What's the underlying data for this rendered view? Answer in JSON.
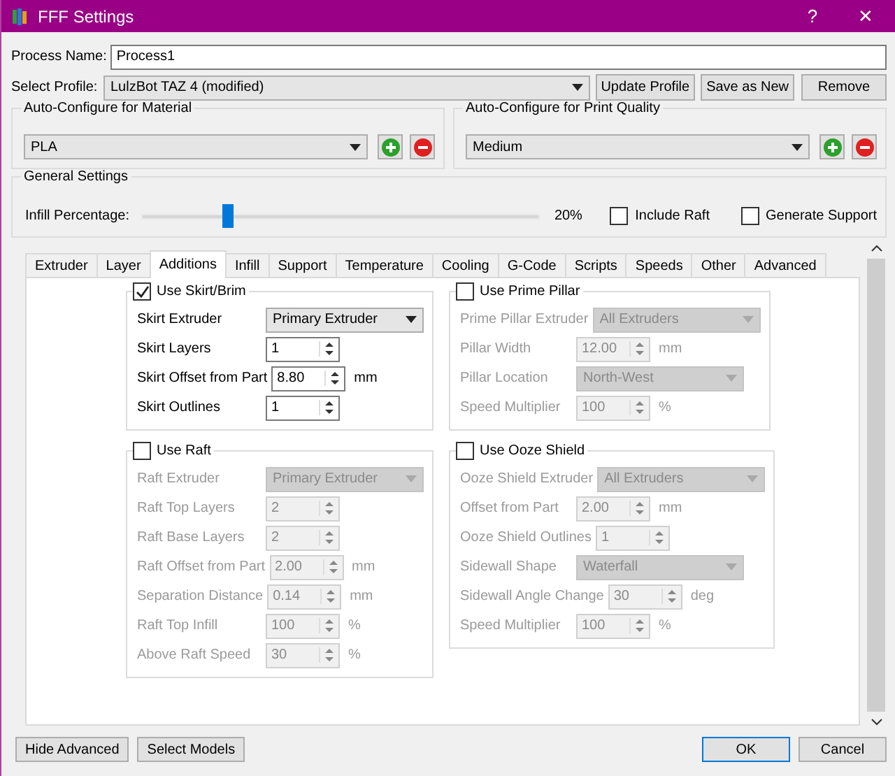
{
  "window": {
    "title": "FFF Settings",
    "help": "?",
    "close": "✕"
  },
  "process_name": {
    "label": "Process Name:",
    "value": "Process1"
  },
  "profile": {
    "label": "Select Profile:",
    "value": "LulzBot TAZ 4 (modified)",
    "buttons": [
      "Update Profile",
      "Save as New",
      "Remove"
    ]
  },
  "auto_configure": [
    {
      "title": "Auto-Configure for Material",
      "value": "PLA"
    },
    {
      "title": "Auto-Configure for Print Quality",
      "value": "Medium"
    }
  ],
  "general_settings": {
    "title": "General Settings",
    "infill_label": "Infill Percentage:",
    "level": 0.21,
    "reading": "20%",
    "options": [
      {
        "label": "Include Raft",
        "checked": false
      },
      {
        "label": "Generate Support",
        "checked": false
      }
    ]
  },
  "tabs": [
    {
      "label": "Extruder",
      "selected": false
    },
    {
      "label": "Layer",
      "selected": false
    },
    {
      "label": "Additions",
      "selected": true
    },
    {
      "label": "Infill",
      "selected": false
    },
    {
      "label": "Support",
      "selected": false
    },
    {
      "label": "Temperature",
      "selected": false
    },
    {
      "label": "Cooling",
      "selected": false
    },
    {
      "label": "G-Code",
      "selected": false
    },
    {
      "label": "Scripts",
      "selected": false
    },
    {
      "label": "Speeds",
      "selected": false
    },
    {
      "label": "Other",
      "selected": false
    },
    {
      "label": "Advanced",
      "selected": false
    }
  ],
  "groups": [
    {
      "label": "Use Skirt/Brim",
      "checked": true,
      "rows": [
        {
          "kind": "combo",
          "label": "Skirt Extruder",
          "value": "Primary Extruder"
        },
        {
          "kind": "spin",
          "label": "Skirt Layers",
          "value": "1"
        },
        {
          "kind": "spin",
          "label": "Skirt Offset from Part",
          "value": "8.80",
          "unit": "mm"
        },
        {
          "kind": "spin",
          "label": "Skirt Outlines",
          "value": "1"
        }
      ]
    },
    {
      "label": "Use Prime Pillar",
      "checked": false,
      "rows": [
        {
          "kind": "combo",
          "label": "Prime Pillar Extruder",
          "value": "All Extruders"
        },
        {
          "kind": "spin",
          "label": "Pillar Width",
          "value": "12.00",
          "unit": "mm"
        },
        {
          "kind": "combo",
          "label": "Pillar Location",
          "value": "North-West"
        },
        {
          "kind": "spin",
          "label": "Speed Multiplier",
          "value": "100",
          "unit": "%"
        }
      ]
    },
    {
      "label": "Use Raft",
      "checked": false,
      "rows": [
        {
          "kind": "combo",
          "label": "Raft Extruder",
          "value": "Primary Extruder"
        },
        {
          "kind": "spin",
          "label": "Raft Top Layers",
          "value": "2"
        },
        {
          "kind": "spin",
          "label": "Raft Base Layers",
          "value": "2"
        },
        {
          "kind": "spin",
          "label": "Raft Offset from Part",
          "value": "2.00",
          "unit": "mm"
        },
        {
          "kind": "spin",
          "label": "Separation Distance",
          "value": "0.14",
          "unit": "mm"
        },
        {
          "kind": "spin",
          "label": "Raft Top Infill",
          "value": "100",
          "unit": "%"
        },
        {
          "kind": "spin",
          "label": "Above Raft Speed",
          "value": "30",
          "unit": "%"
        }
      ]
    },
    {
      "label": "Use Ooze Shield",
      "checked": false,
      "rows": [
        {
          "kind": "combo",
          "label": "Ooze Shield Extruder",
          "value": "All Extruders"
        },
        {
          "kind": "spin",
          "label": "Offset from Part",
          "value": "2.00",
          "unit": "mm"
        },
        {
          "kind": "spin",
          "label": "Ooze Shield Outlines",
          "value": "1"
        },
        {
          "kind": "combo",
          "label": "Sidewall Shape",
          "value": "Waterfall"
        },
        {
          "kind": "spin",
          "label": "Sidewall Angle Change",
          "value": "30",
          "unit": "deg"
        },
        {
          "kind": "spin",
          "label": "Speed Multiplier",
          "value": "100",
          "unit": "%"
        }
      ]
    }
  ],
  "buttons_left": [
    {
      "label": "Hide Advanced",
      "default": false
    },
    {
      "label": "Select Models",
      "default": false
    }
  ],
  "buttons_right": [
    {
      "label": "OK",
      "default": true
    },
    {
      "label": "Cancel",
      "default": false
    }
  ]
}
